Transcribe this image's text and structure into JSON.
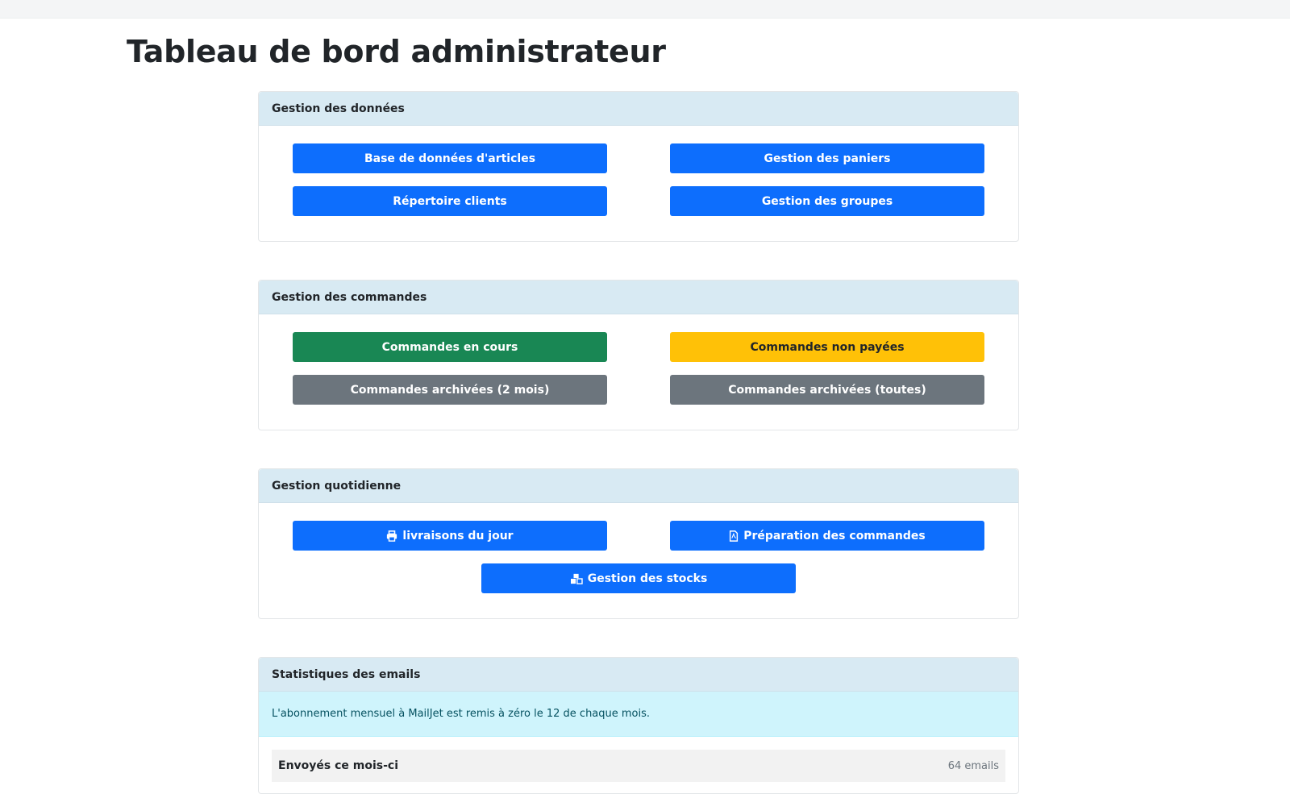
{
  "page": {
    "title": "Tableau de bord administrateur"
  },
  "sections": {
    "data_mgmt": {
      "header": "Gestion des données",
      "buttons": {
        "articles": "Base de données d'articles",
        "paniers": "Gestion des paniers",
        "clients": "Répertoire clients",
        "groupes": "Gestion des groupes"
      }
    },
    "orders": {
      "header": "Gestion des commandes",
      "buttons": {
        "en_cours": "Commandes en cours",
        "non_payees": "Commandes non payées",
        "archived_2m": "Commandes archivées (2 mois)",
        "archived_all": "Commandes archivées (toutes)"
      }
    },
    "daily": {
      "header": "Gestion quotidienne",
      "buttons": {
        "livraisons": "livraisons du jour",
        "preparation": "Préparation des commandes",
        "stocks": "Gestion des stocks"
      },
      "icons": {
        "livraisons": "printer-icon",
        "preparation": "file-pdf-icon",
        "stocks": "boxes-icon"
      }
    },
    "emails": {
      "header": "Statistiques des emails",
      "info": "L'abonnement mensuel à MailJet est remis à zéro le 12 de chaque mois.",
      "sent_label": "Envoyés ce mois-ci",
      "sent_value": "64 emails"
    }
  },
  "colors": {
    "primary": "#0d6efd",
    "success": "#198754",
    "warning": "#ffc107",
    "secondary": "#6c757d",
    "card_header": "#d8eaf3",
    "info_alert": "#cff4fc"
  }
}
